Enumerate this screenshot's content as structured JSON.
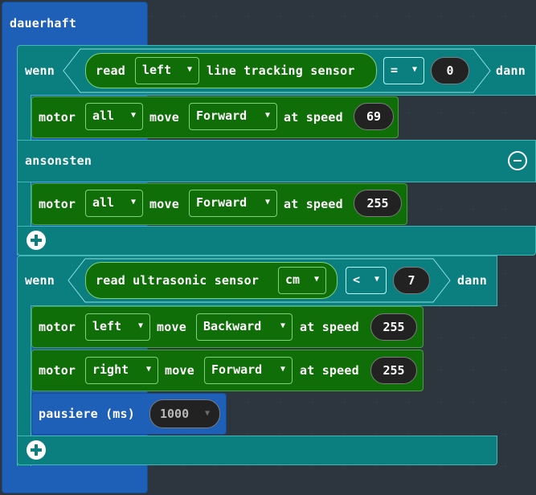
{
  "forever": {
    "label": "dauerhaft"
  },
  "if1": {
    "if_label": "wenn",
    "then_label": "dann",
    "else_label": "ansonsten",
    "condition": {
      "read_label": "read",
      "side_value": "left",
      "sensor_label": "line tracking sensor",
      "operator": "=",
      "compare_value": "0"
    },
    "then_block": {
      "motor_label": "motor",
      "motor_value": "all",
      "move_label": "move",
      "direction_value": "Forward",
      "speed_label": "at speed",
      "speed_value": "69"
    },
    "else_block": {
      "motor_label": "motor",
      "motor_value": "all",
      "move_label": "move",
      "direction_value": "Forward",
      "speed_label": "at speed",
      "speed_value": "255"
    }
  },
  "if2": {
    "if_label": "wenn",
    "then_label": "dann",
    "condition": {
      "read_label": "read ultrasonic sensor",
      "unit_value": "cm",
      "operator": "<",
      "compare_value": "7"
    },
    "block1": {
      "motor_label": "motor",
      "motor_value": "left",
      "move_label": "move",
      "direction_value": "Backward",
      "speed_label": "at speed",
      "speed_value": "255"
    },
    "block2": {
      "motor_label": "motor",
      "motor_value": "right",
      "move_label": "move",
      "direction_value": "Forward",
      "speed_label": "at speed",
      "speed_value": "255"
    },
    "pause": {
      "label": "pausiere (ms)",
      "value": "1000"
    }
  },
  "icons": {
    "dropdown": "▼",
    "add": "plus-circle-icon",
    "remove": "minus-circle-icon"
  },
  "colors": {
    "workspace": "#232a30",
    "loops_blue": "#1e5fb8",
    "logic_teal": "#0b7f80",
    "motor_green": "#0f6e07"
  }
}
